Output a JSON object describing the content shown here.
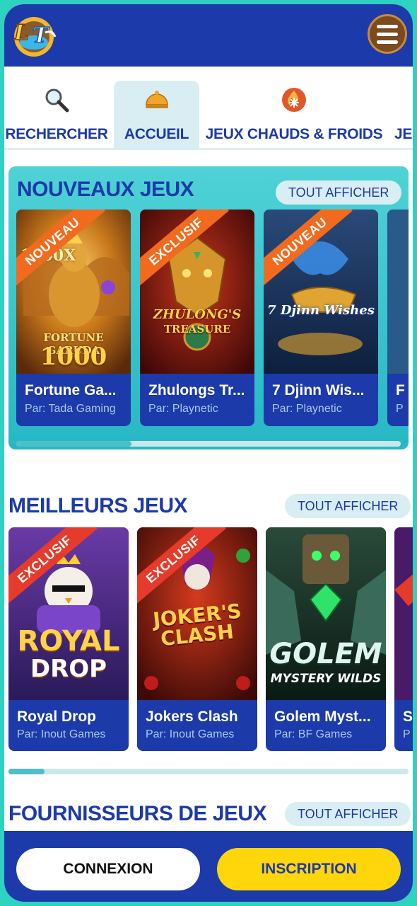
{
  "colors": {
    "brand_blue": "#1c3aa9",
    "frame_teal": "#2fd2c2",
    "ribbon_orange": "#f26a1d",
    "signup_yellow": "#ffd60a",
    "pill_bg": "#d8eef2"
  },
  "header": {
    "logo_icon": "lt-casino-logo",
    "menu_icon": "hamburger-menu-icon"
  },
  "tabs": [
    {
      "label": "RECHERCHER",
      "icon": "magnifier-icon"
    },
    {
      "label": "ACCUEIL",
      "icon": "cloche-icon",
      "active": true
    },
    {
      "label": "JEUX CHAUDS & FROIDS",
      "icon": "fire-snow-icon"
    },
    {
      "label": "JE"
    }
  ],
  "new_games": {
    "title": "NOUVEAUX JEUX",
    "see_all": "TOUT AFFICHER",
    "items": [
      {
        "ribbon": "NOUVEAU",
        "name": "Fortune Ga...",
        "provider": "Par: Tada Gaming",
        "art_title": "FORTUNE GARUDA",
        "art_sub": "1000",
        "art_badge": "1000X"
      },
      {
        "ribbon": "EXCLUSIF",
        "name": "Zhulongs Tr...",
        "provider": "Par: Playnetic",
        "art_title": "ZHULONG'S",
        "art_sub": "TREASURE"
      },
      {
        "ribbon": "NOUVEAU",
        "name": "7 Djinn Wis...",
        "provider": "Par: Playnetic",
        "art_title": "7 Djinn Wishes"
      },
      {
        "name": "F",
        "provider": "P"
      }
    ],
    "scroll_progress": 0.3
  },
  "best_games": {
    "title": "MEILLEURS JEUX",
    "see_all": "TOUT AFFICHER",
    "items": [
      {
        "ribbon": "EXCLUSIF",
        "name": "Royal Drop",
        "provider": "Par: Inout Games",
        "art_title": "ROYAL",
        "art_sub": "DROP"
      },
      {
        "ribbon": "EXCLUSIF",
        "name": "Jokers Clash",
        "provider": "Par: Inout Games",
        "art_title": "JOKER'S",
        "art_sub": "CLASH"
      },
      {
        "name": "Golem Myst...",
        "provider": "Par: BF Games",
        "art_title": "GOLEM",
        "art_sub": "MYSTERY WILDS"
      },
      {
        "ribbon": "E",
        "name": "S",
        "provider": "P"
      }
    ],
    "scroll_progress": 0.09
  },
  "providers": {
    "title": "FOURNISSEURS DE JEUX",
    "see_all": "TOUT AFFICHER"
  },
  "footer": {
    "login": "CONNEXION",
    "signup": "INSCRIPTION"
  }
}
